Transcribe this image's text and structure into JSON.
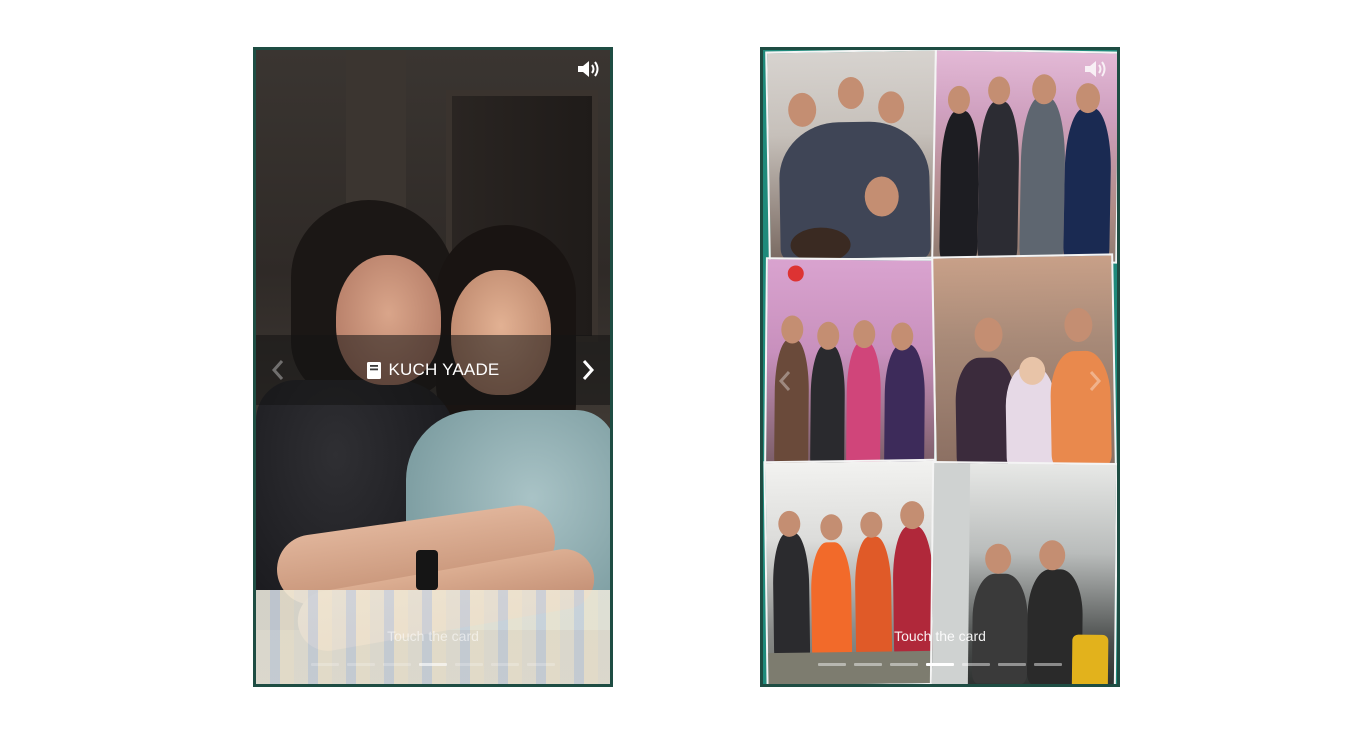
{
  "cards": [
    {
      "id": "left",
      "banner": {
        "title": "KUCH YAADE",
        "icon": "book-icon"
      },
      "hint": "Touch the card",
      "pagination": {
        "count": 7,
        "active_index": 3
      },
      "sound_icon": "volume-icon"
    },
    {
      "id": "right",
      "hint": "Touch the card",
      "pagination": {
        "count": 7,
        "active_index": 3
      },
      "sound_icon": "volume-icon"
    }
  ],
  "colors": {
    "card_border": "#1e4d43",
    "banner_bg": "rgba(20,20,20,0.55)",
    "right_card_bg": "#1f8a7b"
  }
}
